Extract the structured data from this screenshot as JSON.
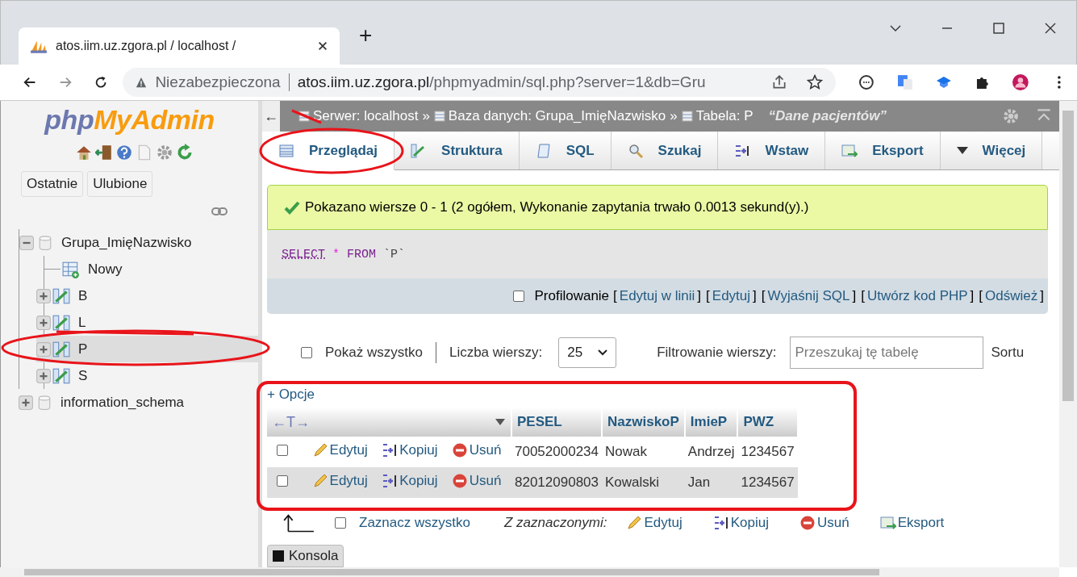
{
  "browser": {
    "tab_title": "atos.iim.uz.zgora.pl / localhost / ",
    "new_tab": "+",
    "security": "Niezabezpieczona",
    "url_host": "atos.iim.uz.zgora.pl",
    "url_path": "/phpmyadmin/sql.php?server=1&db=Gru"
  },
  "sidebar": {
    "logo_php": "php",
    "logo_rest": "MyAdmin",
    "buttons": [
      "Ostatnie",
      "Ulubione"
    ],
    "tree": [
      {
        "name": "Grupa_ImięNazwisko",
        "expanded": true,
        "children": [
          {
            "name": "Nowy",
            "kind": "new",
            "selected": false
          },
          {
            "name": "B",
            "kind": "table",
            "selected": false
          },
          {
            "name": "L",
            "kind": "table",
            "selected": false
          },
          {
            "name": "P",
            "kind": "table",
            "selected": true
          },
          {
            "name": "S",
            "kind": "table",
            "selected": false
          }
        ]
      },
      {
        "name": "information_schema",
        "expanded": false
      }
    ]
  },
  "breadcrumb": {
    "collapse": "←",
    "separator": "»",
    "items": [
      "Serwer: localhost",
      "Baza danych: Grupa_ImięNazwisko",
      "Tabela: P"
    ],
    "comment": "“Dane pacjentów”"
  },
  "tabs": [
    {
      "label": "Przeglądaj",
      "selected": true
    },
    {
      "label": "Struktura",
      "selected": false
    },
    {
      "label": "SQL",
      "selected": false
    },
    {
      "label": "Szukaj",
      "selected": false
    },
    {
      "label": "Wstaw",
      "selected": false
    },
    {
      "label": "Eksport",
      "selected": false
    },
    {
      "label": "Więcej",
      "selected": false
    }
  ],
  "message": "Pokazano wiersze 0 - 1 (2 ogółem, Wykonanie zapytania trwało 0.0013 sekund(y).)",
  "sql": [
    {
      "text": "SELECT",
      "kind": "keyword"
    },
    {
      "text": "*",
      "kind": "operator"
    },
    {
      "text": "FROM",
      "kind": "keyword"
    },
    {
      "text": "`P`",
      "kind": "identifier"
    }
  ],
  "profiling": {
    "label": "Profilowanie",
    "checked": false,
    "bracket_open": "[",
    "bracket_close": "]",
    "links": [
      "Edytuj w linii",
      "Edytuj",
      "Wyjaśnij SQL",
      "Utwórz kod PHP",
      "Odśwież"
    ]
  },
  "controls": {
    "show_all": {
      "label": "Pokaż wszystko",
      "checked": false
    },
    "rows_label": "Liczba wierszy:",
    "rows_value": "25",
    "filter_label": "Filtrowanie wierszy:",
    "filter_placeholder": "Przeszukaj tę tabelę",
    "sort_label": "Sortu"
  },
  "options_link": "+ Opcje",
  "table": {
    "column_arrows": "←T→",
    "columns": [
      "PESEL",
      "NazwiskoP",
      "ImieP",
      "PWZ"
    ],
    "rows": [
      {
        "checked": false,
        "actions": [
          "Edytuj",
          "Kopiuj",
          "Usuń"
        ],
        "cells": [
          "70052000234",
          "Nowak",
          "Andrzej",
          "1234567"
        ]
      },
      {
        "checked": false,
        "actions": [
          "Edytuj",
          "Kopiuj",
          "Usuń"
        ],
        "cells": [
          "82012090803",
          "Kowalski",
          "Jan",
          "1234567"
        ]
      }
    ]
  },
  "footer": {
    "select_all": {
      "label": "Zaznacz wszystko",
      "checked": false
    },
    "with_selected": "Z zaznaczonymi:",
    "actions": [
      "Edytuj",
      "Kopiuj",
      "Usuń",
      "Eksport"
    ]
  },
  "console": "Konsola"
}
